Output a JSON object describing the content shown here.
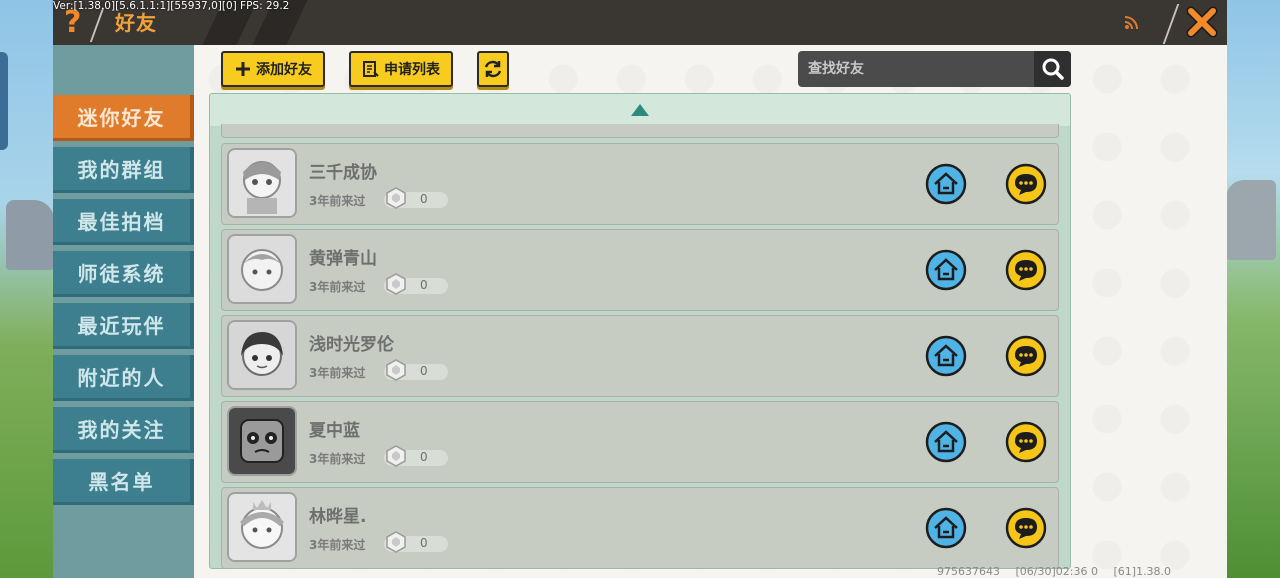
{
  "debug_line": "Ver:[1.38.0][5.6.1.1:1][55937,0][0] FPS: 29.2",
  "header": {
    "title": "好友",
    "help_icon": "question-icon",
    "close_icon": "close-icon",
    "signal_icon": "rss-icon"
  },
  "sidebar": {
    "tabs": [
      {
        "label": "迷你好友",
        "active": true
      },
      {
        "label": "我的群组",
        "active": false
      },
      {
        "label": "最佳拍档",
        "active": false
      },
      {
        "label": "师徒系统",
        "active": false
      },
      {
        "label": "最近玩伴",
        "active": false
      },
      {
        "label": "附近的人",
        "active": false
      },
      {
        "label": "我的关注",
        "active": false
      },
      {
        "label": "黑名单",
        "active": false
      }
    ]
  },
  "toolbar": {
    "add_friend_label": "添加好友",
    "apply_list_label": "申请列表",
    "refresh_icon": "refresh-icon",
    "search_placeholder": "查找好友",
    "search_icon": "search-icon"
  },
  "friends": [
    {
      "name": "三千成协",
      "last_seen": "3年前来过",
      "score": "0"
    },
    {
      "name": "黄弹青山",
      "last_seen": "3年前来过",
      "score": "0"
    },
    {
      "name": "浅时光罗伦",
      "last_seen": "3年前来过",
      "score": "0"
    },
    {
      "name": "夏中蓝",
      "last_seen": "3年前来过",
      "score": "0"
    },
    {
      "name": "林晔星.",
      "last_seen": "3年前来过",
      "score": "0"
    }
  ],
  "footer": {
    "uid": "975637643",
    "date": "[06/30]02:36 0",
    "build": "[61]1.38.0"
  },
  "colors": {
    "accent": "#e07b2b",
    "tab": "#3d7f8e",
    "button": "#f7cc1e",
    "home_button": "#4fb3e6",
    "chat_button": "#f5c518"
  }
}
